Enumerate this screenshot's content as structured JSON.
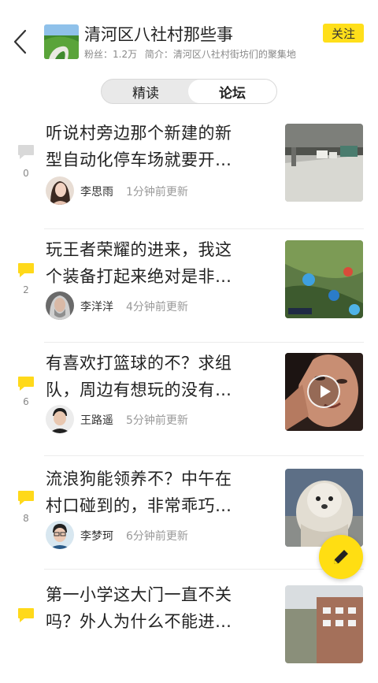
{
  "header": {
    "title": "清河区八社村那些事",
    "fans": "粉丝：1.2万",
    "intro": "简介：清河区八社村街坊们的聚集地",
    "follow_label": "关注"
  },
  "tabs": [
    {
      "label": "精读",
      "selected": false
    },
    {
      "label": "论坛",
      "selected": true
    }
  ],
  "posts": [
    {
      "title_line1": "听说村旁边那个新建的新",
      "title_line2": "型自动化停车场就要开…",
      "author": "李思雨",
      "updated": "1分钟前更新",
      "comments": "0"
    },
    {
      "title_line1": "玩王者荣耀的进来，我这",
      "title_line2": "个装备打起来绝对是非…",
      "author": "李洋洋",
      "updated": "4分钟前更新",
      "comments": "2"
    },
    {
      "title_line1": "有喜欢打篮球的不？求组",
      "title_line2": "队，周边有想玩的没有…",
      "author": "王路遥",
      "updated": "5分钟前更新",
      "comments": "6"
    },
    {
      "title_line1": "流浪狗能领养不？中午在",
      "title_line2": "村口碰到的，非常乖巧…",
      "author": "李梦珂",
      "updated": "6分钟前更新",
      "comments": "8"
    },
    {
      "title_line1": "第一小学这大门一直不关",
      "title_line2": "吗？外人为什么不能进…",
      "author": "",
      "updated": "",
      "comments": ""
    }
  ],
  "colors": {
    "accent_yellow": "#ffdf1a",
    "comment_empty": "#d9d9d9"
  },
  "icons": {
    "back": "chevron-left-icon",
    "comment": "speech-bubble-icon",
    "play": "play-icon",
    "compose": "pencil-icon"
  }
}
